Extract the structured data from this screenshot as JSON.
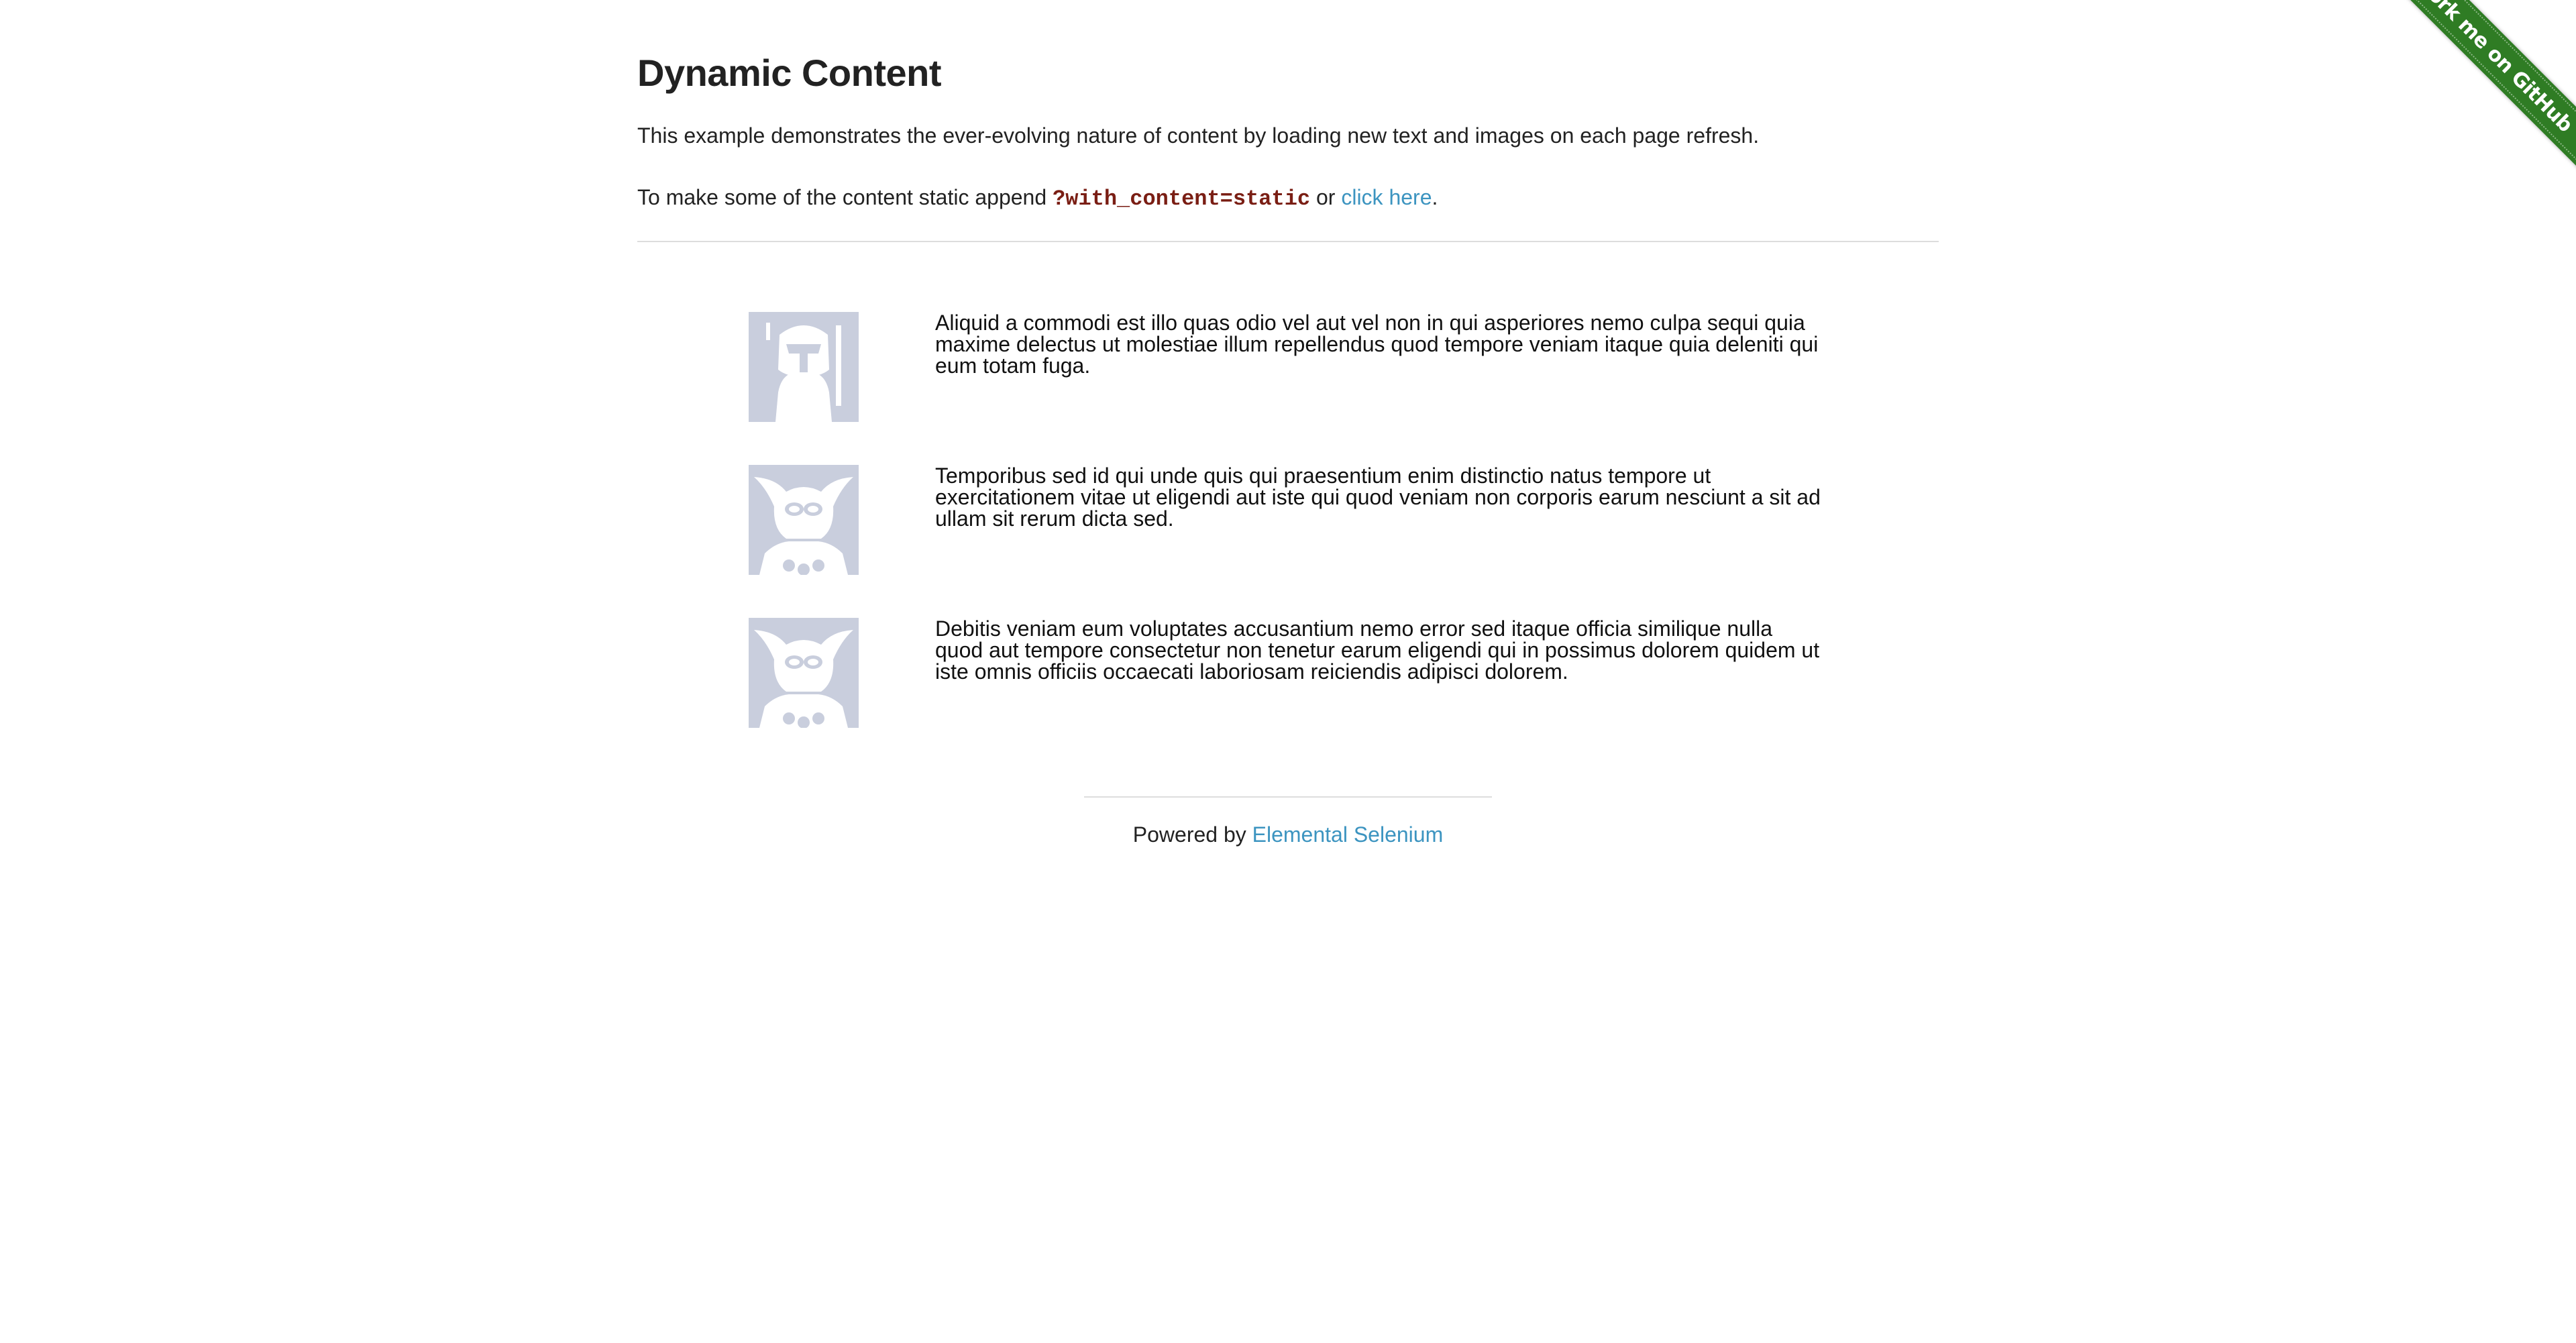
{
  "ribbon": {
    "label": "Fork me on GitHub",
    "color": "#2f7c24"
  },
  "header": {
    "title": "Dynamic Content"
  },
  "intro": {
    "description": "This example demonstrates the ever-evolving nature of content by loading new text and images on each page refresh.",
    "static_prefix": "To make some of the content static append ",
    "static_param": "?with_content=static",
    "static_or": " or ",
    "static_link": "click here",
    "static_suffix": "."
  },
  "rows": [
    {
      "avatar_icon": "helmet-avatar-icon",
      "text": "Aliquid a commodi est illo quas odio vel aut vel non in qui asperiores nemo culpa sequi quia maxime delectus ut molestiae illum repellendus quod tempore veniam itaque quia deleniti qui eum totam fuga."
    },
    {
      "avatar_icon": "jester-avatar-icon",
      "text": "Temporibus sed id qui unde quis qui praesentium enim distinctio natus tempore ut exercitationem vitae ut eligendi aut iste qui quod veniam non corporis earum nesciunt a sit ad ullam sit rerum dicta sed."
    },
    {
      "avatar_icon": "jester-avatar-icon",
      "text": "Debitis veniam eum voluptates accusantium nemo error sed itaque officia similique nulla quod aut tempore consectetur non tenetur earum eligendi qui in possimus dolorem quidem ut iste omnis officiis occaecati laboriosam reiciendis adipisci dolorem."
    }
  ],
  "footer": {
    "prefix": "Powered by ",
    "link": "Elemental Selenium"
  },
  "colors": {
    "link": "#3c94c0",
    "code": "#7a1e14",
    "avatar_bg": "#c9cedd"
  }
}
